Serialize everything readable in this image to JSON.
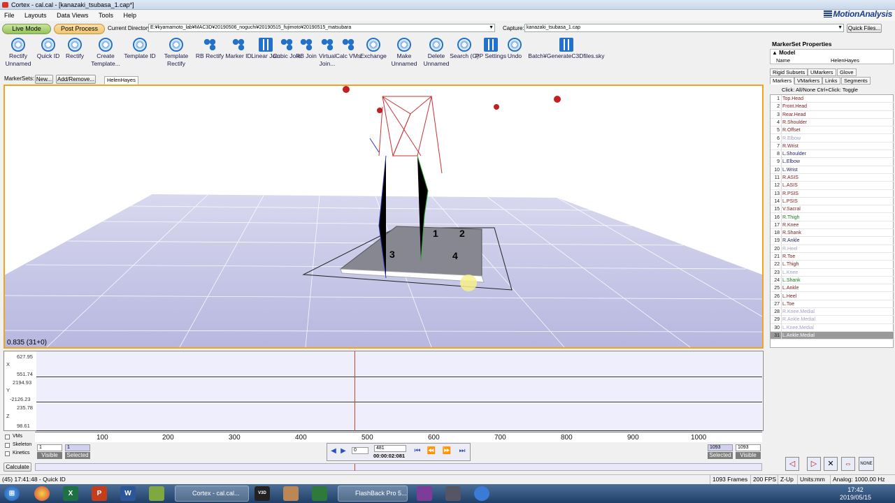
{
  "window": {
    "title": "Cortex - cal.cal - [kanazaki_tsubasa_1.cap*]",
    "logo": "MotionAnalysis"
  },
  "menu": [
    "File",
    "Layouts",
    "Data Views",
    "Tools",
    "Help"
  ],
  "modes": {
    "live": "Live Mode",
    "post": "Post Process"
  },
  "directory": {
    "label": "Current Directory:",
    "value": "E:¥kyamamoto_lab¥MAC3D¥20190506_noguchi¥20190515_fujimoto¥20190515_matsubara",
    "capture_label": "Capture:",
    "capture_value": "kanazaki_tsubasa_1.cap",
    "quick_files": "Quick Files..."
  },
  "toolbar": [
    {
      "label": "Rectify Unnamed",
      "icon": "rectify-unnamed-icon"
    },
    {
      "label": "Quick ID",
      "icon": "quick-id-icon"
    },
    {
      "label": "Rectify",
      "icon": "rectify-icon"
    },
    {
      "label": "Create Template...",
      "icon": "create-template-icon"
    },
    {
      "label": "Template ID",
      "icon": "template-id-icon"
    },
    {
      "label": "Template Rectify",
      "icon": "template-rectify-icon"
    },
    {
      "label": "RB Rectify",
      "icon": "rb-rectify-icon"
    },
    {
      "label": "Marker ID",
      "icon": "marker-id-icon"
    },
    {
      "label": "Linear Join",
      "icon": "linear-join-icon"
    },
    {
      "label": "Cubic Join",
      "icon": "cubic-join-icon"
    },
    {
      "label": "RB Join",
      "icon": "rb-join-icon"
    },
    {
      "label": "Virtual Join...",
      "icon": "virtual-join-icon"
    },
    {
      "label": "Calc VMs",
      "icon": "calc-vms-icon"
    },
    {
      "label": "Exchange",
      "icon": "exchange-icon"
    },
    {
      "label": "Make Unnamed",
      "icon": "make-unnamed-icon"
    },
    {
      "label": "Delete Unnamed",
      "icon": "delete-unnamed-icon"
    },
    {
      "label": "Search (G)",
      "icon": "search-icon"
    },
    {
      "label": "PP Settings",
      "icon": "pp-settings-icon"
    },
    {
      "label": "Undo",
      "icon": "undo-icon"
    }
  ],
  "batch": {
    "label": "Batch¥GenerateC3Dfiles.sky"
  },
  "markersets": {
    "label": "MarkerSets:",
    "new_btn": "New...",
    "addremove_btn": "Add/Remove...",
    "tab": "HelenHayes"
  },
  "viewport": {
    "info": "0.835 (31+0)",
    "plate_markers": [
      "1",
      "2",
      "3",
      "4"
    ]
  },
  "graphs": {
    "x": {
      "axis": "X",
      "max": "627.95",
      "min": "551.74"
    },
    "y": {
      "axis": "Y",
      "max": "2194.93",
      "min": "-2126.23"
    },
    "z": {
      "axis": "Z",
      "max": "235.78",
      "min": "98.61"
    }
  },
  "ruler": [
    "100",
    "200",
    "300",
    "400",
    "500",
    "600",
    "700",
    "800",
    "900",
    "1000"
  ],
  "playback": {
    "vms": "VMs",
    "skeleton": "Skeleton",
    "kinetics": "Kinetics",
    "start_visible": "1",
    "start_selected": "1",
    "visible_label": "Visible",
    "selected_label": "Selected",
    "step": "0",
    "frame": "481",
    "time": "00:00:02:081",
    "end_selected": "1093",
    "end_visible": "1093",
    "calculate": "Calculate"
  },
  "status": {
    "left": "(45) 17:41:48 - Quick ID",
    "frames": "1093 Frames",
    "fps": "200 FPS",
    "zup": "Z-Up",
    "units": "Units:mm",
    "analog": "Analog: 1000.00 Hz"
  },
  "markerset_props": {
    "title": "MarkerSet Properties",
    "model_label": "Model",
    "name_label": "Name",
    "name_value": "HelenHayes",
    "tabs_row1": [
      "Rigid Subsets",
      "UMarkers",
      "Glove"
    ],
    "tabs_row2": [
      "Markers",
      "VMarkers",
      "Links",
      "Segments"
    ],
    "click_hint": "Click: All/None  Ctrl+Click: Toggle",
    "markers": [
      {
        "n": "1",
        "name": "Top.Head",
        "color": "#7a1c1c"
      },
      {
        "n": "2",
        "name": "Front.Head",
        "color": "#7a1c1c"
      },
      {
        "n": "3",
        "name": "Rear.Head",
        "color": "#7a1c1c"
      },
      {
        "n": "4",
        "name": "R.Shoulder",
        "color": "#7a1c1c"
      },
      {
        "n": "5",
        "name": "R.Offset",
        "color": "#7a1c1c"
      },
      {
        "n": "6",
        "name": "R.Elbow",
        "color": "#a0a0c8"
      },
      {
        "n": "7",
        "name": "R.Wrist",
        "color": "#7a1c1c"
      },
      {
        "n": "8",
        "name": "L.Shoulder",
        "color": "#22226a"
      },
      {
        "n": "9",
        "name": "L.Elbow",
        "color": "#22226a"
      },
      {
        "n": "10",
        "name": "L.Wrist",
        "color": "#22226a"
      },
      {
        "n": "11",
        "name": "R.ASIS",
        "color": "#7a1c1c"
      },
      {
        "n": "12",
        "name": "L.ASIS",
        "color": "#7a1c1c"
      },
      {
        "n": "13",
        "name": "R.PSIS",
        "color": "#7a1c1c"
      },
      {
        "n": "14",
        "name": "L.PSIS",
        "color": "#7a1c1c"
      },
      {
        "n": "15",
        "name": "V.Sacral",
        "color": "#7a1c1c"
      },
      {
        "n": "16",
        "name": "R.Thigh",
        "color": "#1e7a1e"
      },
      {
        "n": "17",
        "name": "R.Knee",
        "color": "#7a1c1c"
      },
      {
        "n": "18",
        "name": "R.Shank",
        "color": "#7a1c1c"
      },
      {
        "n": "19",
        "name": "R.Ankle",
        "color": "#22226a"
      },
      {
        "n": "20",
        "name": "R.Heel",
        "color": "#a0a0c8"
      },
      {
        "n": "21",
        "name": "R.Toe",
        "color": "#7a1c1c"
      },
      {
        "n": "22",
        "name": "L.Thigh",
        "color": "#7a1c1c"
      },
      {
        "n": "23",
        "name": "L.Knee",
        "color": "#a0a0c8"
      },
      {
        "n": "24",
        "name": "L.Shank",
        "color": "#1e7a1e"
      },
      {
        "n": "25",
        "name": "L.Ankle",
        "color": "#7a1c1c"
      },
      {
        "n": "26",
        "name": "L.Heel",
        "color": "#7a1c1c"
      },
      {
        "n": "27",
        "name": "L.Toe",
        "color": "#7a1c1c"
      },
      {
        "n": "28",
        "name": "R.Knee.Medial",
        "color": "#a0a0c8"
      },
      {
        "n": "29",
        "name": "R.Ankle.Medial",
        "color": "#a0a0c8"
      },
      {
        "n": "30",
        "name": "L.Knee.Medial",
        "color": "#a0a0c8"
      },
      {
        "n": "31",
        "name": "L.Ankle.Medial",
        "color": "#ffffff"
      }
    ]
  },
  "nav_none": "NONE",
  "taskbar": {
    "windows": [
      "Cortex - cal.cal...",
      "FlashBack Pro 5..."
    ],
    "time": "17:42",
    "date": "2019/05/15"
  }
}
